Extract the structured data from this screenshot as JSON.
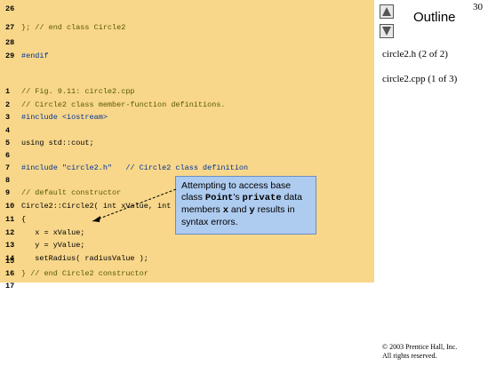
{
  "slide_number": "30",
  "outline": {
    "title": "Outline",
    "items": [
      "circle2.h (2 of 2)",
      "circle2.cpp (1 of 3)"
    ]
  },
  "code_lines": [
    {
      "num": "26",
      "text": "",
      "kind": "plain"
    },
    {
      "num": "27",
      "text": "}; // end class Circle2",
      "kind": "comment"
    },
    {
      "num": "28",
      "text": "",
      "kind": "plain"
    },
    {
      "num": "29",
      "text": "#endif",
      "kind": "dir"
    },
    {
      "num": "1",
      "text": "// Fig. 9.11: circle2.cpp",
      "kind": "comment"
    },
    {
      "num": "2",
      "text": "// Circle2 class member-function definitions.",
      "kind": "comment"
    },
    {
      "num": "3",
      "text": "#include <iostream>",
      "kind": "dir"
    },
    {
      "num": "4",
      "text": "",
      "kind": "plain"
    },
    {
      "num": "5",
      "text": "using std::cout;",
      "kind": "plain"
    },
    {
      "num": "6",
      "text": "",
      "kind": "plain"
    },
    {
      "num": "7",
      "text": "#include \"circle2.h\"   // Circle2 class definition",
      "kind": "dir"
    },
    {
      "num": "8",
      "text": "",
      "kind": "plain"
    },
    {
      "num": "9",
      "text": "// default constructor",
      "kind": "comment"
    },
    {
      "num": "10",
      "text": "Circle2::Circle2( int xValue, int yValue, double radiusValue )",
      "kind": "plain"
    },
    {
      "num": "11",
      "text": "{",
      "kind": "plain"
    },
    {
      "num": "12",
      "text": "   x = xValue;",
      "kind": "plain"
    },
    {
      "num": "13",
      "text": "   y = yValue;",
      "kind": "plain"
    },
    {
      "num": "14",
      "text": "   setRadius( radiusValue );",
      "kind": "plain"
    },
    {
      "num": "15",
      "text": "",
      "kind": "plain"
    },
    {
      "num": "16",
      "text": "} // end Circle2 constructor",
      "kind": "comment"
    },
    {
      "num": "17",
      "text": "",
      "kind": "plain"
    }
  ],
  "callout": {
    "part1": "Attempting to access base class ",
    "mono1": "Point",
    "part2": "'s ",
    "mono2": "private",
    "part3": " data members ",
    "mono3": "x",
    "part4": " and ",
    "mono4": "y",
    "part5": " results in syntax errors."
  },
  "copyright": {
    "line1": "© 2003 Prentice Hall, Inc.",
    "line2": "All rights reserved."
  },
  "colors": {
    "code_background": "#f8d78a",
    "callout_background": "#aecbf0"
  },
  "icons": [
    "up-arrow-icon",
    "down-arrow-icon"
  ]
}
